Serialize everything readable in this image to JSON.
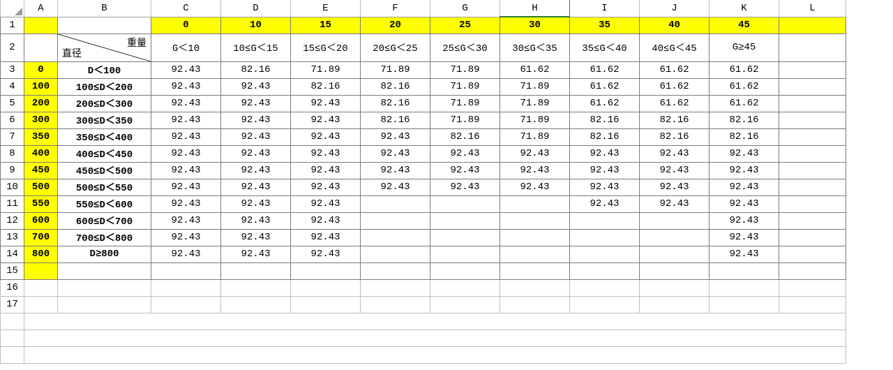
{
  "columns": [
    "",
    "A",
    "B",
    "C",
    "D",
    "E",
    "F",
    "G",
    "H",
    "I",
    "J",
    "K",
    "L"
  ],
  "rowHeaders": [
    "1",
    "2",
    "3",
    "4",
    "5",
    "6",
    "7",
    "8",
    "9",
    "10",
    "11",
    "12",
    "13",
    "14",
    "15",
    "16",
    "17"
  ],
  "selectedColumn": "H",
  "diagCell": {
    "topRight": "重量",
    "bottomLeft": "直径"
  },
  "weightHeaders": [
    "0",
    "10",
    "15",
    "20",
    "25",
    "30",
    "35",
    "40",
    "45"
  ],
  "weightRanges": [
    "G＜10",
    "10≤G＜15",
    "15≤G＜20",
    "20≤G＜25",
    "25≤G＜30",
    "30≤G＜35",
    "35≤G＜40",
    "40≤G＜45",
    "G≥45"
  ],
  "diamKeys": [
    "0",
    "100",
    "200",
    "300",
    "350",
    "400",
    "450",
    "500",
    "550",
    "600",
    "700",
    "800"
  ],
  "diamRanges": [
    "D＜100",
    "100≤D＜200",
    "200≤D＜300",
    "300≤D＜350",
    "350≤D＜400",
    "400≤D＜450",
    "450≤D＜500",
    "500≤D＜550",
    "550≤D＜600",
    "600≤D＜700",
    "700≤D＜800",
    "D≥800"
  ],
  "chart_data": {
    "type": "table",
    "title": "",
    "xlabel": "重量 G",
    "ylabel": "直径 D",
    "x_categories": [
      "G＜10",
      "10≤G＜15",
      "15≤G＜20",
      "20≤G＜25",
      "25≤G＜30",
      "30≤G＜35",
      "35≤G＜40",
      "40≤G＜45",
      "G≥45"
    ],
    "y_categories": [
      "D＜100",
      "100≤D＜200",
      "200≤D＜300",
      "300≤D＜350",
      "350≤D＜400",
      "400≤D＜450",
      "450≤D＜500",
      "500≤D＜550",
      "550≤D＜600",
      "600≤D＜700",
      "700≤D＜800",
      "D≥800"
    ],
    "values": [
      [
        92.43,
        82.16,
        71.89,
        71.89,
        71.89,
        61.62,
        61.62,
        61.62,
        61.62
      ],
      [
        92.43,
        92.43,
        82.16,
        82.16,
        71.89,
        71.89,
        61.62,
        61.62,
        61.62
      ],
      [
        92.43,
        92.43,
        92.43,
        82.16,
        71.89,
        71.89,
        61.62,
        61.62,
        61.62
      ],
      [
        92.43,
        92.43,
        92.43,
        82.16,
        71.89,
        71.89,
        82.16,
        82.16,
        82.16
      ],
      [
        92.43,
        92.43,
        92.43,
        92.43,
        82.16,
        71.89,
        82.16,
        82.16,
        82.16
      ],
      [
        92.43,
        92.43,
        92.43,
        92.43,
        92.43,
        92.43,
        92.43,
        92.43,
        92.43
      ],
      [
        92.43,
        92.43,
        92.43,
        92.43,
        92.43,
        92.43,
        92.43,
        92.43,
        92.43
      ],
      [
        92.43,
        92.43,
        92.43,
        92.43,
        92.43,
        92.43,
        92.43,
        92.43,
        92.43
      ],
      [
        92.43,
        92.43,
        92.43,
        null,
        null,
        null,
        92.43,
        92.43,
        92.43
      ],
      [
        92.43,
        92.43,
        92.43,
        null,
        null,
        null,
        null,
        null,
        92.43
      ],
      [
        92.43,
        92.43,
        92.43,
        null,
        null,
        null,
        null,
        null,
        92.43
      ],
      [
        92.43,
        92.43,
        92.43,
        null,
        null,
        null,
        null,
        null,
        92.43
      ]
    ]
  }
}
